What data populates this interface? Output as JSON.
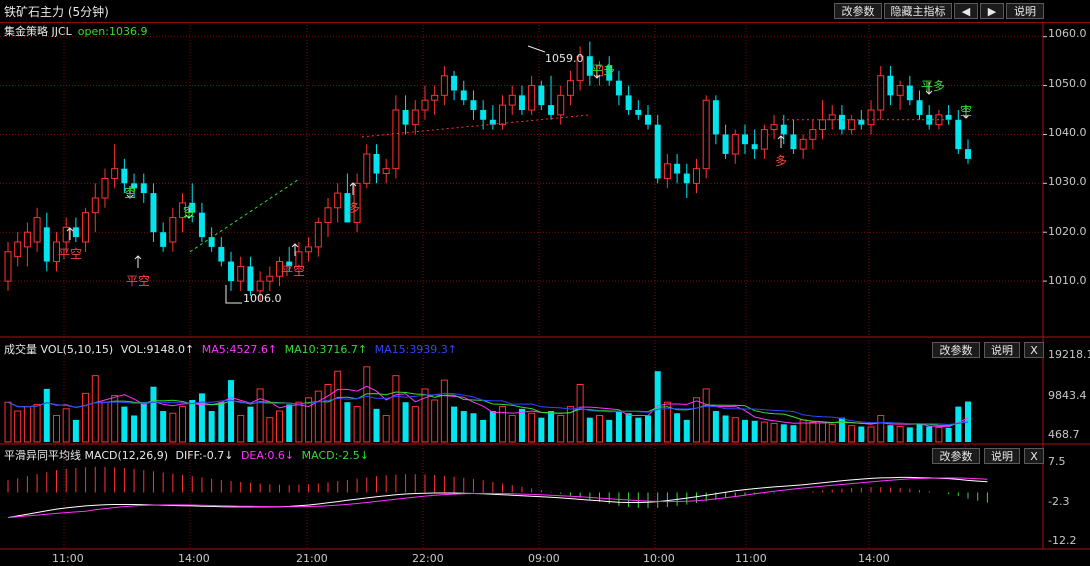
{
  "window": {
    "title": "铁矿石主力 (5分钟)",
    "buttons": [
      "改参数",
      "隐藏主指标",
      "◀",
      "▶",
      "说明"
    ]
  },
  "strategy": {
    "name": "集金策略 JJCL",
    "open_label": "open:1036.9"
  },
  "price_axis": [
    "1060.0",
    "1050.0",
    "1040.0",
    "1030.0",
    "1020.0",
    "1010.0"
  ],
  "price_annotations": {
    "high_label": "1059.0",
    "low_label": "1006.0"
  },
  "signals": [
    {
      "text": "平空",
      "color": "#ff4040",
      "arrow": "up"
    },
    {
      "text": "空",
      "color": "#33dd33",
      "arrow": "down"
    },
    {
      "text": "平空",
      "color": "#ff4040",
      "arrow": "up"
    },
    {
      "text": "空",
      "color": "#33dd33",
      "arrow": "down"
    },
    {
      "text": "平空",
      "color": "#ff4040",
      "arrow": "up"
    },
    {
      "text": "多",
      "color": "#ff4040",
      "arrow": "up"
    },
    {
      "text": "平多",
      "color": "#33dd33",
      "arrow": "down"
    },
    {
      "text": "多",
      "color": "#ff4040",
      "arrow": "up"
    },
    {
      "text": "平多",
      "color": "#33dd33",
      "arrow": "down"
    },
    {
      "text": "空",
      "color": "#33dd33",
      "arrow": "down"
    }
  ],
  "volume_panel": {
    "label": "成交量 VOL(5,10,15)",
    "vol": "VOL:9148.0↑",
    "ma5": "MA5:4527.6↑",
    "ma10": "MA10:3716.7↑",
    "ma15": "MA15:3939.3↑",
    "axis": [
      "19218.1",
      "9843.4",
      "468.7"
    ],
    "buttons": [
      "改参数",
      "说明",
      "X"
    ]
  },
  "macd_panel": {
    "label": "平滑异同平均线 MACD(12,26,9)",
    "diff": "DIFF:-0.7↓",
    "dea": "DEA:0.6↓",
    "macd": "MACD:-2.5↓",
    "axis": [
      "7.5",
      "-2.3",
      "-12.2"
    ],
    "buttons": [
      "改参数",
      "说明",
      "X"
    ]
  },
  "time_axis": [
    "11:00",
    "14:00",
    "21:00",
    "22:00",
    "09:00",
    "10:00",
    "11:00",
    "14:00"
  ],
  "colors": {
    "up": "#ff3232",
    "down": "#00e5ee",
    "ma5": "#ff33ff",
    "ma10": "#33dd33",
    "ma15": "#3344ff",
    "grid": "#7a0a0a",
    "macd_pos": "#ff3232",
    "macd_neg": "#33dd33"
  },
  "chart_data": {
    "type": "candlestick",
    "ylim": [
      1000,
      1063
    ],
    "candles": [
      [
        1010,
        1018,
        1008,
        1016
      ],
      [
        1015,
        1020,
        1013,
        1018
      ],
      [
        1017,
        1022,
        1013,
        1020
      ],
      [
        1018,
        1025,
        1016,
        1023
      ],
      [
        1021,
        1024,
        1012,
        1014
      ],
      [
        1014,
        1020,
        1012,
        1018
      ],
      [
        1018,
        1023,
        1016,
        1021
      ],
      [
        1021,
        1023,
        1018,
        1019
      ],
      [
        1018,
        1025,
        1016,
        1024
      ],
      [
        1024,
        1030,
        1020,
        1027
      ],
      [
        1027,
        1033,
        1025,
        1031
      ],
      [
        1031,
        1038,
        1029,
        1033
      ],
      [
        1033,
        1035,
        1028,
        1030
      ],
      [
        1030,
        1032,
        1027,
        1029
      ],
      [
        1030,
        1032,
        1026,
        1028
      ],
      [
        1028,
        1030,
        1018,
        1020
      ],
      [
        1020,
        1022,
        1016,
        1017
      ],
      [
        1018,
        1025,
        1016,
        1023
      ],
      [
        1023,
        1028,
        1020,
        1026
      ],
      [
        1026,
        1030,
        1022,
        1024
      ],
      [
        1024,
        1026,
        1018,
        1019
      ],
      [
        1019,
        1021,
        1016,
        1017
      ],
      [
        1017,
        1019,
        1013,
        1014
      ],
      [
        1014,
        1016,
        1008,
        1010
      ],
      [
        1010,
        1015,
        1008,
        1013
      ],
      [
        1013,
        1015,
        1007,
        1008
      ],
      [
        1008,
        1012,
        1006,
        1010
      ],
      [
        1010,
        1013,
        1008,
        1011
      ],
      [
        1011,
        1015,
        1009,
        1014
      ],
      [
        1014,
        1017,
        1012,
        1013
      ],
      [
        1013,
        1018,
        1011,
        1016
      ],
      [
        1016,
        1019,
        1014,
        1017
      ],
      [
        1017,
        1023,
        1015,
        1022
      ],
      [
        1022,
        1027,
        1019,
        1025
      ],
      [
        1025,
        1030,
        1022,
        1028
      ],
      [
        1028,
        1032,
        1025,
        1022
      ],
      [
        1022,
        1032,
        1020,
        1030
      ],
      [
        1030,
        1038,
        1029,
        1036
      ],
      [
        1036,
        1038,
        1030,
        1032
      ],
      [
        1032,
        1035,
        1030,
        1033
      ],
      [
        1033,
        1048,
        1031,
        1045
      ],
      [
        1045,
        1048,
        1040,
        1042
      ],
      [
        1042,
        1047,
        1040,
        1045
      ],
      [
        1045,
        1050,
        1043,
        1047
      ],
      [
        1047,
        1050,
        1044,
        1048
      ],
      [
        1048,
        1054,
        1046,
        1052
      ],
      [
        1052,
        1053,
        1047,
        1049
      ],
      [
        1049,
        1051,
        1046,
        1047
      ],
      [
        1047,
        1049,
        1043,
        1045
      ],
      [
        1045,
        1047,
        1041,
        1043
      ],
      [
        1043,
        1046,
        1041,
        1042
      ],
      [
        1042,
        1048,
        1041,
        1046
      ],
      [
        1046,
        1050,
        1044,
        1048
      ],
      [
        1048,
        1050,
        1044,
        1045
      ],
      [
        1045,
        1052,
        1044,
        1050
      ],
      [
        1050,
        1051,
        1045,
        1046
      ],
      [
        1046,
        1052,
        1043,
        1044
      ],
      [
        1044,
        1050,
        1042,
        1048
      ],
      [
        1048,
        1053,
        1046,
        1051
      ],
      [
        1051,
        1058,
        1049,
        1056
      ],
      [
        1056,
        1059,
        1050,
        1052
      ],
      [
        1052,
        1055,
        1050,
        1054
      ],
      [
        1054,
        1056,
        1050,
        1051
      ],
      [
        1051,
        1053,
        1046,
        1048
      ],
      [
        1048,
        1050,
        1044,
        1045
      ],
      [
        1045,
        1047,
        1043,
        1044
      ],
      [
        1044,
        1046,
        1041,
        1042
      ],
      [
        1042,
        1044,
        1030,
        1031
      ],
      [
        1031,
        1036,
        1029,
        1034
      ],
      [
        1034,
        1036,
        1030,
        1032
      ],
      [
        1032,
        1034,
        1027,
        1030
      ],
      [
        1030,
        1035,
        1028,
        1033
      ],
      [
        1033,
        1048,
        1031,
        1047
      ],
      [
        1047,
        1048,
        1038,
        1040
      ],
      [
        1040,
        1042,
        1035,
        1036
      ],
      [
        1036,
        1041,
        1034,
        1040
      ],
      [
        1040,
        1042,
        1036,
        1038
      ],
      [
        1038,
        1041,
        1035,
        1037
      ],
      [
        1037,
        1042,
        1035,
        1041
      ],
      [
        1041,
        1044,
        1039,
        1042
      ],
      [
        1042,
        1044,
        1038,
        1040
      ],
      [
        1040,
        1043,
        1036,
        1037
      ],
      [
        1037,
        1040,
        1035,
        1039
      ],
      [
        1039,
        1043,
        1037,
        1041
      ],
      [
        1041,
        1047,
        1039,
        1043
      ],
      [
        1043,
        1046,
        1041,
        1044
      ],
      [
        1044,
        1046,
        1040,
        1041
      ],
      [
        1041,
        1044,
        1040,
        1043
      ],
      [
        1043,
        1045,
        1041,
        1042
      ],
      [
        1042,
        1047,
        1040,
        1045
      ],
      [
        1045,
        1054,
        1043,
        1052
      ],
      [
        1052,
        1054,
        1046,
        1048
      ],
      [
        1048,
        1051,
        1045,
        1050
      ],
      [
        1050,
        1052,
        1046,
        1047
      ],
      [
        1047,
        1049,
        1043,
        1044
      ],
      [
        1044,
        1046,
        1041,
        1042
      ],
      [
        1042,
        1045,
        1041,
        1044
      ],
      [
        1044,
        1046,
        1042,
        1043
      ],
      [
        1043,
        1045,
        1036,
        1037
      ],
      [
        1037,
        1039,
        1034,
        1035
      ]
    ],
    "volumes": [
      9000,
      7000,
      8000,
      8500,
      12000,
      6000,
      7500,
      5000,
      11000,
      15000,
      9000,
      10500,
      8000,
      6000,
      9000,
      12500,
      7000,
      6500,
      8000,
      9500,
      11000,
      7000,
      9000,
      14000,
      6000,
      8000,
      12000,
      5500,
      7000,
      8500,
      9000,
      10000,
      11500,
      13000,
      16000,
      9000,
      8000,
      17000,
      7500,
      6000,
      15000,
      9000,
      8000,
      12000,
      9500,
      14000,
      8000,
      7000,
      6500,
      5000,
      7000,
      8000,
      6000,
      7500,
      6500,
      5500,
      7000,
      6000,
      8000,
      13000,
      5500,
      6000,
      5000,
      7000,
      6500,
      5500,
      6000,
      16000,
      9000,
      6500,
      5000,
      10000,
      12000,
      7000,
      6000,
      5500,
      5000,
      4800,
      4500,
      4200,
      4000,
      3800,
      5000,
      4500,
      4300,
      4000,
      5500,
      3700,
      3500,
      3400,
      6000,
      3800,
      3500,
      3300,
      4000,
      3500,
      3300,
      3200,
      8000,
      9148
    ],
    "macd": [
      3,
      3.5,
      4,
      4.5,
      5,
      5.5,
      5.8,
      6,
      6.2,
      6.3,
      6.3,
      6.2,
      6,
      5.8,
      5.5,
      5.2,
      4.9,
      4.6,
      4.3,
      4,
      3.7,
      3.4,
      3.1,
      2.8,
      2.6,
      2.4,
      2.2,
      2,
      1.9,
      1.8,
      1.9,
      2,
      2.2,
      2.5,
      2.8,
      3.1,
      3.4,
      3.7,
      4,
      4.2,
      4.4,
      4.5,
      4.5,
      4.4,
      4.3,
      4.1,
      3.9,
      3.6,
      3.3,
      3,
      2.6,
      2.2,
      1.8,
      1.4,
      1,
      0.6,
      0.2,
      -0.3,
      -0.8,
      -1.3,
      -1.8,
      -2.3,
      -2.8,
      -3.3,
      -3.6,
      -3.8,
      -3.9,
      -3.8,
      -3.6,
      -3.3,
      -3,
      -2.6,
      -2.2,
      -1.8,
      -1.4,
      -1,
      -0.7,
      -0.5,
      -0.3,
      -0.2,
      -0.1,
      0,
      0.1,
      0.3,
      0.5,
      0.7,
      0.9,
      1.1,
      1.2,
      1.3,
      1.3,
      1.2,
      1.1,
      0.9,
      0.6,
      0.3,
      0,
      -0.4,
      -0.9,
      -1.5,
      -2,
      -2.5
    ]
  }
}
